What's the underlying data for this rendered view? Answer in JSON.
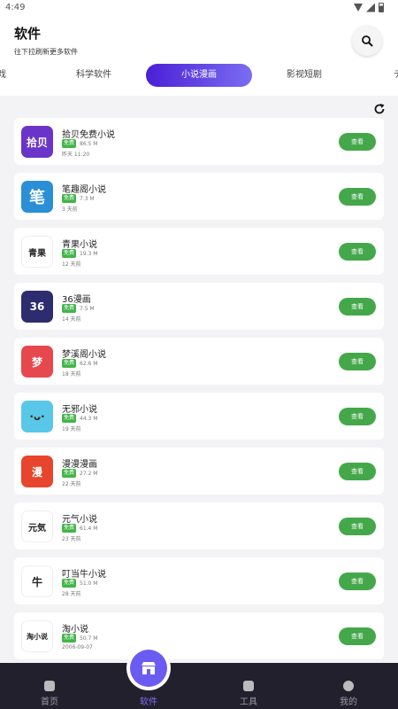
{
  "status_bar": {
    "time": "4:49"
  },
  "header": {
    "title": "软件",
    "subtitle": "往下拉刷新更多软件"
  },
  "tabs": [
    {
      "label": "戏"
    },
    {
      "label": "科学软件"
    },
    {
      "label": "小说漫画",
      "active": true
    },
    {
      "label": "影视短剧"
    },
    {
      "label": "デ"
    }
  ],
  "free_badge": "免费",
  "view_label": "查看",
  "apps": [
    {
      "name": "拾贝免费小说",
      "size": "86.5 M",
      "updated": "昨天 11:20",
      "icon": "shibei-icon",
      "icon_text": "拾贝",
      "icon_color": "#6b34c9"
    },
    {
      "name": "笔趣阁小说",
      "size": "7.3 M",
      "updated": "3 天前",
      "icon": "biquge-icon",
      "icon_text": "笔",
      "icon_color": "#2a8fd6"
    },
    {
      "name": "青果小说",
      "size": "19.3 M",
      "updated": "12 天前",
      "icon": "qingguo-icon",
      "icon_text": "青果",
      "icon_color": "#ffffff"
    },
    {
      "name": "36漫画",
      "size": "7.5 M",
      "updated": "14 天前",
      "icon": "manhua36-icon",
      "icon_text": "36",
      "icon_color": "#2c2c6e"
    },
    {
      "name": "梦溪阁小说",
      "size": "62.6 M",
      "updated": "18 天前",
      "icon": "mengxige-icon",
      "icon_text": "梦",
      "icon_color": "#e7484e"
    },
    {
      "name": "无邪小说",
      "size": "44.3 M",
      "updated": "19 天前",
      "icon": "wuxie-icon",
      "icon_text": "·ᴗ·",
      "icon_color": "#59c8e8"
    },
    {
      "name": "漫漫漫画",
      "size": "27.2 M",
      "updated": "22 天前",
      "icon": "manman-icon",
      "icon_text": "漫",
      "icon_color": "#e8452e"
    },
    {
      "name": "元气小说",
      "size": "61.4 M",
      "updated": "23 天前",
      "icon": "yuanqi-icon",
      "icon_text": "元気",
      "icon_color": "#ffffff"
    },
    {
      "name": "叮当牛小说",
      "size": "51.0 M",
      "updated": "28 天前",
      "icon": "dingdangniu-icon",
      "icon_text": "牛",
      "icon_color": "#ffffff"
    },
    {
      "name": "淘小说",
      "size": "50.7 M",
      "updated": "2006-09-07",
      "icon": "taoxiaoshuo-icon",
      "icon_text": "淘小说",
      "icon_color": "#ffffff"
    }
  ],
  "bottom_nav": [
    {
      "label": "首页",
      "icon": "home-icon"
    },
    {
      "label": "软件",
      "icon": "store-icon",
      "active": true
    },
    {
      "label": "工具",
      "icon": "toolbox-icon"
    },
    {
      "label": "我的",
      "icon": "user-icon"
    }
  ]
}
